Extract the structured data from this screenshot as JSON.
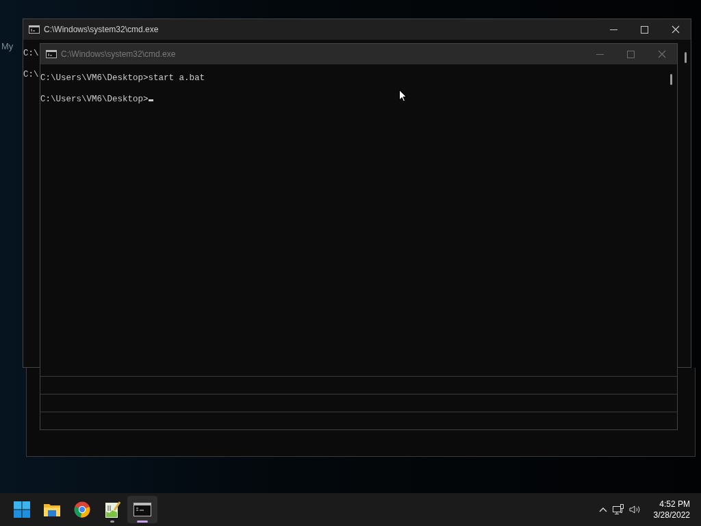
{
  "desktop": {
    "icon_labels": [
      "My"
    ]
  },
  "windows": [
    {
      "title": "C:\\Windows\\system32\\cmd.exe",
      "active": true,
      "lines": [
        "C:\\",
        "C:\\"
      ],
      "cursor": false
    },
    {
      "title": "C:\\Windows\\system32\\cmd.exe",
      "active": false,
      "lines": [
        "C:\\Users\\VM6\\Desktop>start a.bat",
        "C:\\Users\\VM6\\Desktop>"
      ],
      "cursor": true
    }
  ],
  "taskbar": {
    "apps": [
      {
        "kind": "start",
        "running": false,
        "selected": false
      },
      {
        "kind": "explorer",
        "running": false,
        "selected": false
      },
      {
        "kind": "chrome",
        "running": false,
        "selected": false
      },
      {
        "kind": "notepad",
        "running": true,
        "selected": false
      },
      {
        "kind": "terminal",
        "running": true,
        "selected": true
      }
    ],
    "clock": {
      "time": "4:52 PM",
      "date": "3/28/2022"
    }
  }
}
